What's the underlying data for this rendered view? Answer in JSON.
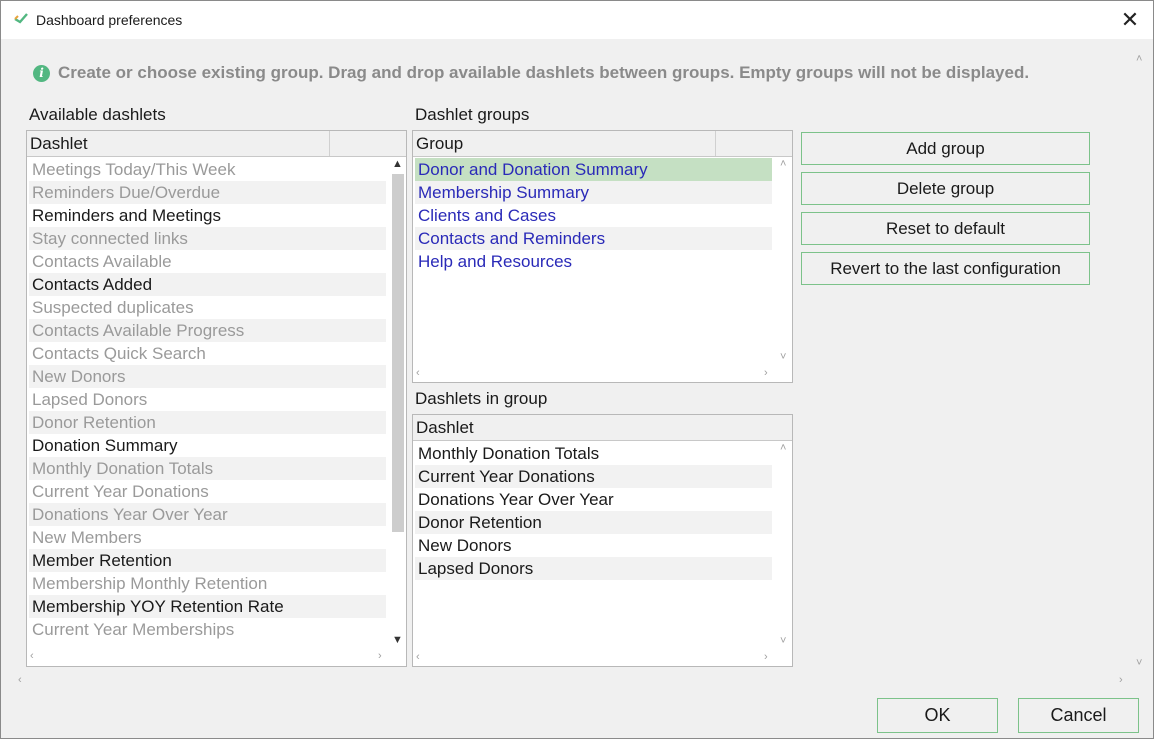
{
  "window": {
    "title": "Dashboard preferences",
    "close_glyph": "✕"
  },
  "info": {
    "icon": "i",
    "text": "Create or choose existing group. Drag and drop available dashlets between groups. Empty groups will not be displayed."
  },
  "available": {
    "label": "Available dashlets",
    "column": "Dashlet",
    "items": [
      {
        "label": "Meetings Today/This Week",
        "state": "dim"
      },
      {
        "label": "Reminders Due/Overdue",
        "state": "dim"
      },
      {
        "label": "Reminders and Meetings",
        "state": "act"
      },
      {
        "label": "Stay connected links",
        "state": "dim"
      },
      {
        "label": "Contacts Available",
        "state": "dim"
      },
      {
        "label": "Contacts Added",
        "state": "act"
      },
      {
        "label": "Suspected duplicates",
        "state": "dim"
      },
      {
        "label": "Contacts Available Progress",
        "state": "dim"
      },
      {
        "label": "Contacts Quick Search",
        "state": "dim"
      },
      {
        "label": "New Donors",
        "state": "dim"
      },
      {
        "label": "Lapsed Donors",
        "state": "dim"
      },
      {
        "label": "Donor Retention",
        "state": "dim"
      },
      {
        "label": "Donation Summary",
        "state": "act"
      },
      {
        "label": "Monthly Donation Totals",
        "state": "dim"
      },
      {
        "label": "Current Year Donations",
        "state": "dim"
      },
      {
        "label": "Donations Year Over Year",
        "state": "dim"
      },
      {
        "label": "New Members",
        "state": "dim"
      },
      {
        "label": "Member Retention",
        "state": "act"
      },
      {
        "label": "Membership Monthly Retention",
        "state": "dim"
      },
      {
        "label": "Membership YOY Retention Rate",
        "state": "act"
      },
      {
        "label": "Current Year Memberships",
        "state": "dim"
      }
    ]
  },
  "groups": {
    "label": "Dashlet groups",
    "column": "Group",
    "items": [
      {
        "label": "Donor and Donation Summary",
        "selected": true
      },
      {
        "label": "Membership Summary",
        "selected": false
      },
      {
        "label": "Clients and Cases",
        "selected": false
      },
      {
        "label": "Contacts and Reminders",
        "selected": false
      },
      {
        "label": "Help and Resources",
        "selected": false
      }
    ]
  },
  "in_group": {
    "label": "Dashlets in group",
    "column": "Dashlet",
    "items": [
      "Monthly Donation Totals",
      "Current Year Donations",
      "Donations Year Over Year",
      "Donor Retention",
      "New Donors",
      "Lapsed Donors"
    ]
  },
  "buttons": {
    "add_group": "Add group",
    "delete_group": "Delete group",
    "reset_default": "Reset to default",
    "revert": "Revert to the last configuration",
    "ok": "OK",
    "cancel": "Cancel"
  },
  "colors": {
    "accent": "#52b781",
    "selection": "#c5e0c3",
    "link": "#2a2ab8",
    "dim_text": "#9a9a9a",
    "button_border": "#7cc28a"
  }
}
